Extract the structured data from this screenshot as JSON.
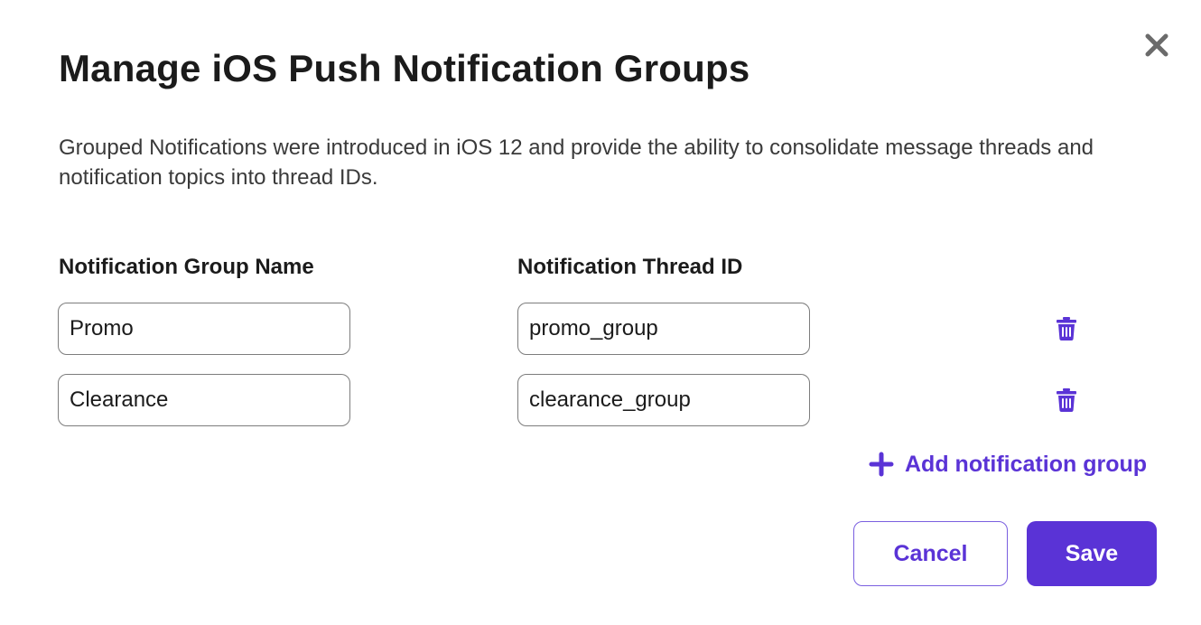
{
  "dialog": {
    "title": "Manage iOS Push Notification Groups",
    "description": "Grouped Notifications were introduced in iOS 12 and provide the ability to consolidate message threads and notification topics into thread IDs.",
    "close_icon": "close-icon"
  },
  "columns": {
    "name_header": "Notification Group Name",
    "thread_header": "Notification Thread ID"
  },
  "groups": [
    {
      "name": "Promo",
      "thread_id": "promo_group",
      "delete_icon": "trash-icon"
    },
    {
      "name": "Clearance",
      "thread_id": "clearance_group",
      "delete_icon": "trash-icon"
    }
  ],
  "add_group": {
    "label": "Add notification group",
    "icon": "plus-icon"
  },
  "actions": {
    "cancel_label": "Cancel",
    "save_label": "Save"
  },
  "colors": {
    "accent": "#5a33d6",
    "text": "#1b1b1b",
    "input_border": "#7d7d7d"
  }
}
